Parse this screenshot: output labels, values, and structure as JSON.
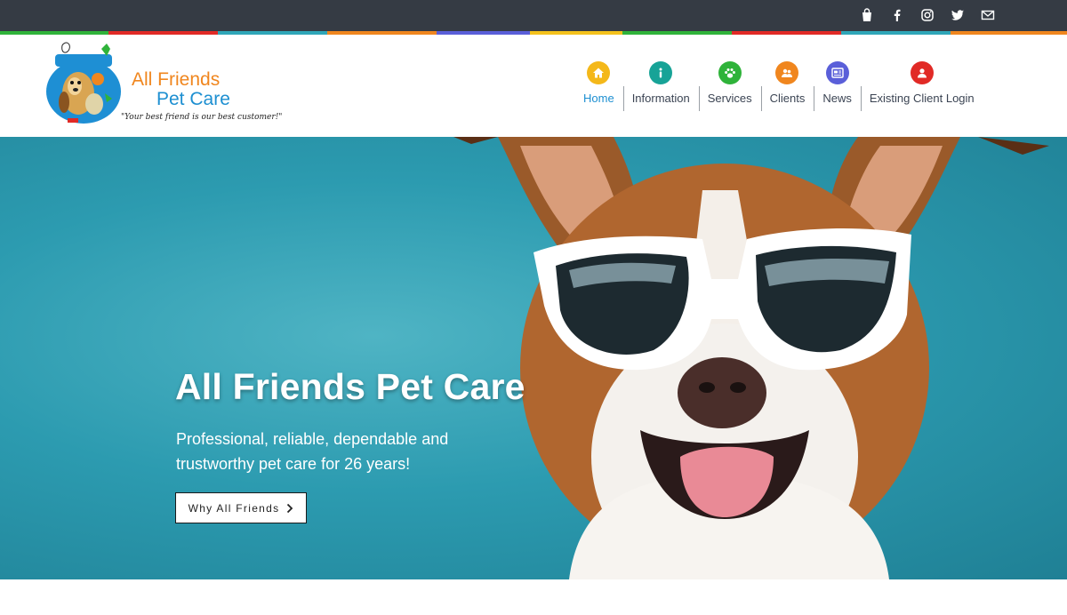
{
  "social": {
    "icons": [
      "shopping-bag-icon",
      "facebook-icon",
      "instagram-icon",
      "twitter-icon",
      "email-icon"
    ]
  },
  "stripe_colors": [
    "#2fb33a",
    "#e12a26",
    "#2fa6b8",
    "#f0861e",
    "#5a5fd9",
    "#f4c21c",
    "#2fb33a",
    "#e12a26",
    "#2fa6b8",
    "#f0861e"
  ],
  "logo": {
    "line1": "All Friends",
    "line2": "Pet Care",
    "tagline": "\"Your best friend is our best customer!\""
  },
  "nav": {
    "items": [
      {
        "label": "Home",
        "icon": "home-icon",
        "color": "#f4b81a",
        "active": true
      },
      {
        "label": "Information",
        "icon": "info-icon",
        "color": "#17a397"
      },
      {
        "label": "Services",
        "icon": "paw-icon",
        "color": "#2fb33a"
      },
      {
        "label": "Clients",
        "icon": "clients-icon",
        "color": "#f0861e"
      },
      {
        "label": "News",
        "icon": "news-icon",
        "color": "#5a5fd9"
      },
      {
        "label": "Existing Client Login",
        "icon": "user-icon",
        "color": "#e12a26"
      }
    ]
  },
  "hero": {
    "title": "All Friends Pet Care",
    "subtitle": "Professional, reliable, dependable and trustworthy pet care for 26 years!",
    "button_label": "Why All Friends",
    "image": "dog-with-sunglasses"
  },
  "colors": {
    "topbar": "#353b44",
    "hero_bg": "#2c9bb0",
    "active_nav": "#1d8fd1"
  }
}
